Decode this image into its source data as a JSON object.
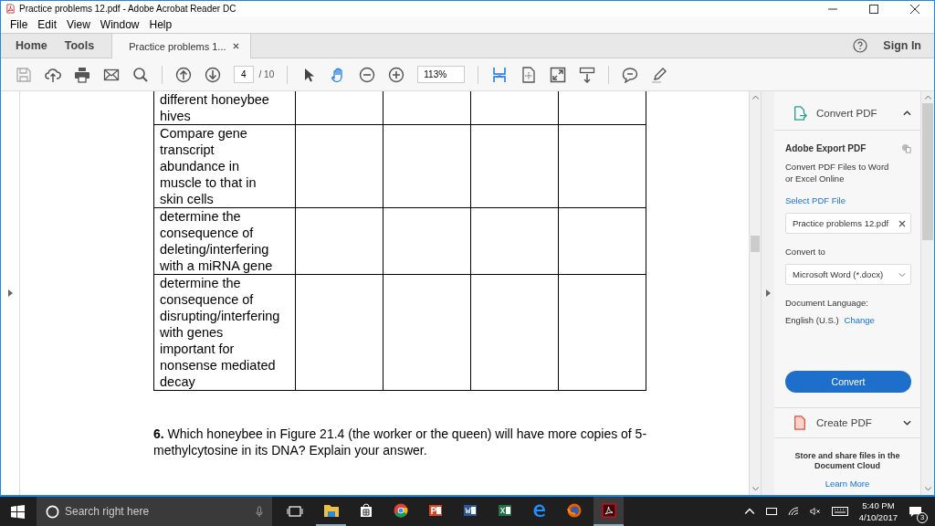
{
  "window": {
    "title": "Practice problems 12.pdf - Adobe Acrobat Reader DC"
  },
  "menu": [
    "File",
    "Edit",
    "View",
    "Window",
    "Help"
  ],
  "tabs": [
    {
      "label": "Home",
      "selected": false,
      "kind": "nav"
    },
    {
      "label": "Tools",
      "selected": false,
      "kind": "nav"
    },
    {
      "label": "Practice problems 1...",
      "selected": true,
      "kind": "document"
    }
  ],
  "sign_in": "Sign In",
  "toolbar": {
    "page": "4",
    "page_count": "/ 10",
    "zoom": "113%"
  },
  "table": {
    "rows": [
      {
        "cells": [
          "different honeybee\nhives",
          "",
          "",
          "",
          ""
        ]
      },
      {
        "cells": [
          "Compare gene\ntranscript\nabundance in\nmuscle to that in\nskin cells",
          "",
          "",
          "",
          ""
        ]
      },
      {
        "cells": [
          "determine the\nconsequence of\ndeleting/interfering\nwith a miRNA gene",
          "",
          "",
          "",
          ""
        ]
      },
      {
        "cells": [
          "determine the\nconsequence of\ndisrupting/interfering\nwith genes\nimportant for\nnonsense mediated\ndecay",
          "",
          "",
          "",
          ""
        ]
      }
    ]
  },
  "question": "**6.** Which honeybee in Figure 21.4 (the worker or the queen) will have more copies of 5-methylcytosine in its DNA?  Explain your answer.",
  "panel": {
    "convert_header": {
      "label": "Convert PDF",
      "expanded": true
    },
    "title": "Adobe Export PDF",
    "description": "Convert PDF Files to Word\nor Excel Online",
    "select_label": "Select PDF File",
    "file": "Practice problems 12.pdf",
    "convert_to_label": "Convert to",
    "format": "Microsoft Word (*.docx)",
    "language_label": "Document Language:",
    "language": "English (U.S.)",
    "change_link": "Change",
    "convert_button": "Convert",
    "create_header": {
      "label": "Create PDF",
      "expanded": false
    },
    "cloud_text": "Store and share files in the Document Cloud",
    "learn_more": "Learn More"
  },
  "taskbar": {
    "search_placeholder": "Search right here",
    "time": "5:40 PM",
    "date": "4/10/2017",
    "notifications": "3"
  }
}
